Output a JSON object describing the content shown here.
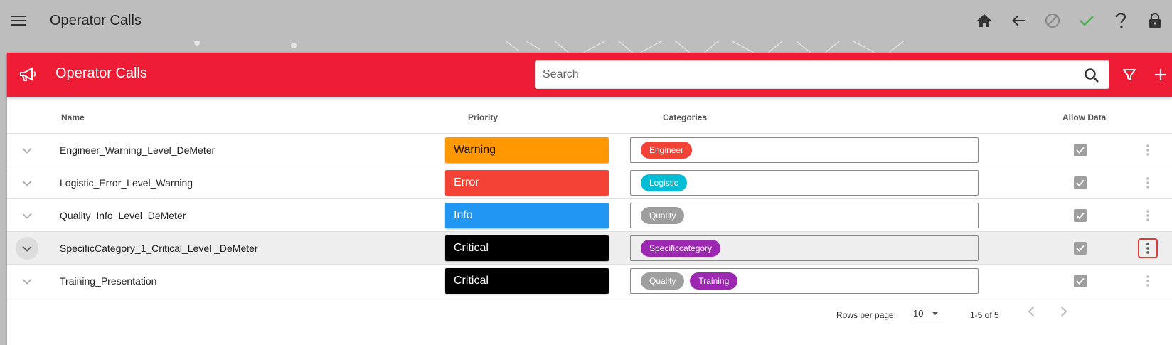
{
  "appbar": {
    "title": "Operator Calls",
    "icons": [
      "menu-icon",
      "home-icon",
      "arrow-back-icon",
      "block-icon",
      "check-icon",
      "help-icon",
      "lock-icon"
    ]
  },
  "card": {
    "title": "Operator Calls",
    "header_icon": "megaphone-icon",
    "search_placeholder": "Search",
    "actions": [
      "filter-icon",
      "add-icon"
    ]
  },
  "table": {
    "columns": {
      "name": "Name",
      "priority": "Priority",
      "categories": "Categories",
      "allow_data": "Allow Data"
    },
    "rows": [
      {
        "name": "Engineer_Warning_Level_DeMeter",
        "priority": "Warning",
        "priority_color": "#ff9800",
        "priority_text_color": "#111111",
        "categories": [
          {
            "label": "Engineer",
            "color": "#f44336"
          }
        ],
        "allow_data": true
      },
      {
        "name": "Logistic_Error_Level_Warning",
        "priority": "Error",
        "priority_color": "#f44336",
        "priority_text_color": "#ffffff",
        "categories": [
          {
            "label": "Logistic",
            "color": "#00bcd4"
          }
        ],
        "allow_data": true
      },
      {
        "name": "Quality_Info_Level_DeMeter",
        "priority": "Info",
        "priority_color": "#2196f3",
        "priority_text_color": "#ffffff",
        "categories": [
          {
            "label": "Quality",
            "color": "#9e9e9e"
          }
        ],
        "allow_data": true
      },
      {
        "name": "SpecificCategory_1_Critical_Level _DeMeter",
        "priority": "Critical",
        "priority_color": "#000000",
        "priority_text_color": "#ffffff",
        "categories": [
          {
            "label": "Specificcategory",
            "color": "#9c27b0"
          }
        ],
        "allow_data": true
      },
      {
        "name": "Training_Presentation",
        "priority": "Critical",
        "priority_color": "#000000",
        "priority_text_color": "#ffffff",
        "categories": [
          {
            "label": "Quality",
            "color": "#9e9e9e"
          },
          {
            "label": "Training",
            "color": "#9c27b0"
          }
        ],
        "allow_data": true
      }
    ]
  },
  "pagination": {
    "rows_per_page_label": "Rows per page:",
    "rows_per_page_value": "10",
    "range": "1-5 of 5"
  },
  "colors": {
    "header_red": "#ee1c34",
    "appbar_gray": "#bdbdbd",
    "check_green": "#4caf50"
  }
}
